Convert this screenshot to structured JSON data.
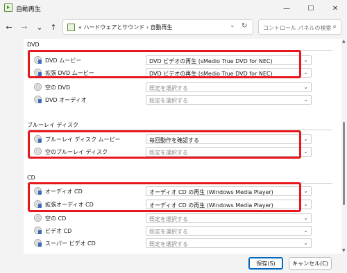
{
  "window": {
    "title": "自動再生",
    "minimize": "—",
    "maximize": "☐",
    "close": "✕"
  },
  "nav": {
    "back": "←",
    "forward": "→",
    "recent": "⌄",
    "up": "↑",
    "address": "«  ハードウェアとサウンド  ›  自動再生",
    "address_chevron": "⌄",
    "refresh": "↻",
    "search_placeholder": "コントロール パネルの検索",
    "search_icon": "⌕"
  },
  "sections": [
    {
      "title": "DVD",
      "rows": [
        {
          "label": "DVD ムービー",
          "value": "DVD ビデオの再生 (sMedio True DVD for NEC)",
          "icon": "dvd-movie-icon",
          "highlight": true
        },
        {
          "label": "拡張 DVD ムービー",
          "value": "DVD ビデオの再生 (sMedio True DVD for NEC)",
          "icon": "enhanced-dvd-movie-icon",
          "highlight": true
        },
        {
          "label": "空の DVD",
          "value": "既定を選択する",
          "icon": "blank-dvd-icon",
          "highlight": false
        },
        {
          "label": "DVD オーディオ",
          "value": "既定を選択する",
          "icon": "dvd-audio-icon",
          "highlight": false
        }
      ]
    },
    {
      "title": "ブルーレイ ディスク",
      "rows": [
        {
          "label": "ブルーレイ ディスク ムービー",
          "value": "毎回動作を確認する",
          "icon": "bluray-movie-icon",
          "highlight": true
        },
        {
          "label": "空のブルーレイ ディスク",
          "value": "既定を選択する",
          "icon": "blank-bluray-icon",
          "highlight": true
        }
      ]
    },
    {
      "title": "CD",
      "rows": [
        {
          "label": "オーディオ CD",
          "value": "オーディオ CD の再生 (Windows Media Player)",
          "icon": "audio-cd-icon",
          "highlight": true
        },
        {
          "label": "拡張オーディオ CD",
          "value": "オーディオ CD の再生 (Windows Media Player)",
          "icon": "enhanced-audio-cd-icon",
          "highlight": true
        },
        {
          "label": "空の CD",
          "value": "既定を選択する",
          "icon": "blank-cd-icon",
          "highlight": false
        },
        {
          "label": "ビデオ CD",
          "value": "既定を選択する",
          "icon": "video-cd-icon",
          "highlight": false
        },
        {
          "label": "スーパー ビデオ CD",
          "value": "既定を選択する",
          "icon": "super-video-cd-icon",
          "highlight": false
        }
      ]
    }
  ],
  "select_chevron": "⌄",
  "footer": {
    "save": "保存(S)",
    "cancel": "キャンセル(C)"
  },
  "colors": {
    "highlight": "#e8161d",
    "primary_border": "#0067c0"
  }
}
